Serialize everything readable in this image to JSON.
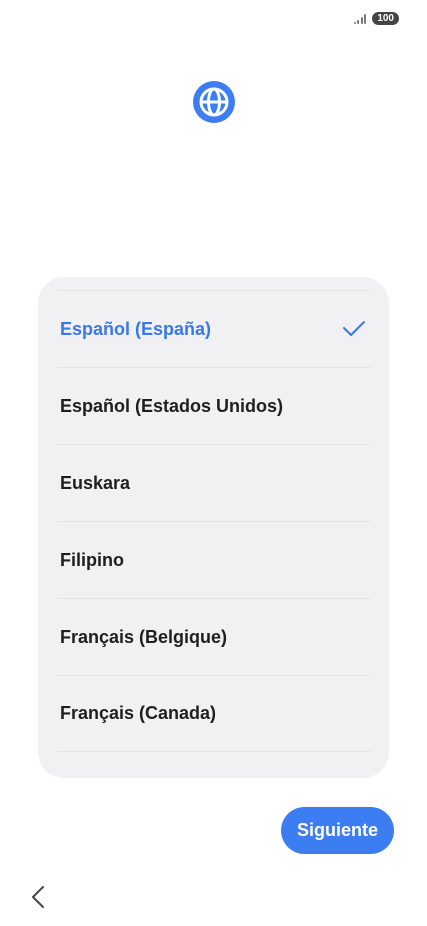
{
  "status_bar": {
    "battery": "100",
    "signal_icon": "signal-icon"
  },
  "header": {
    "icon": "globe-icon"
  },
  "languages": [
    {
      "label": "Español (España)",
      "selected": true
    },
    {
      "label": "Español (Estados Unidos)",
      "selected": false
    },
    {
      "label": "Euskara",
      "selected": false
    },
    {
      "label": "Filipino",
      "selected": false
    },
    {
      "label": "Français (Belgique)",
      "selected": false
    },
    {
      "label": "Français (Canada)",
      "selected": false
    }
  ],
  "footer": {
    "next_label": "Siguiente",
    "back_icon": "chevron-left-icon"
  },
  "colors": {
    "accent": "#3d7df2",
    "selected_text": "#3b78e7",
    "card_bg": "#f1f1f3"
  }
}
